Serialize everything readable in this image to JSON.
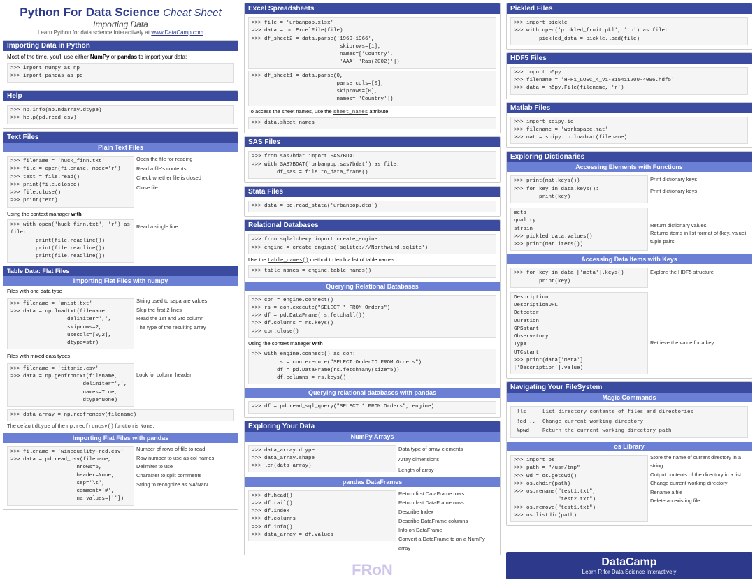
{
  "header": {
    "title_bold": "Python For Data Science",
    "title_italic": "Cheat Sheet",
    "subtitle": "Importing Data",
    "link_text": "Learn Python for data science Interactively at",
    "link_url": "www.DataCamp.com"
  },
  "sections": {
    "importing_python": {
      "title": "Importing Data in Python",
      "body": "Most of the time, you'll use either NumPy or pandas to import your data:",
      "code": ">>> import numpy as np\n>>> import pandas as pd"
    },
    "help": {
      "title": "Help",
      "code": ">>> np.info(np.ndarray.dtype)\n>>> help(pd.read_csv)"
    },
    "text_files": {
      "title": "Text Files",
      "plain_text": {
        "subtitle": "Plain Text Files",
        "code1": ">>> filename = 'huck_finn.txt'\n>>> file = open(filename, mode='r')\n>>> text = file.read()\n>>> print(file.closed)\n>>> file.close()\n>>> print(text)",
        "notes": [
          "Open the file for reading",
          "Read a file's contents",
          "Check whether file is closed",
          "Close file"
        ]
      },
      "context_manager": {
        "label": "Using the context manager with",
        "code": ">>> with open('huck_finn.txt', 'r') as file:\n        print(file.readline())\n        print(file.readline())\n        print(file.readline())",
        "note": "Read a single line"
      },
      "flat_files": {
        "subtitle": "Table Data: Flat Files",
        "numpy_subtitle": "Importing Flat Files with numpy",
        "one_dtype": "Files with one data type",
        "code1": ">>> filename = 'mnist.txt'\n>>> data = np.loadtxt(filename,\n                      delimiter=',',\n                      skiprows=2,\n                      usecols=[0,2],\n                      dtype=str)",
        "notes1": [
          "String used to separate values",
          "Skip the first 2 lines",
          "Read the 1st and 3rd column",
          "The type of the resulting array"
        ],
        "mixed_dtype": "Files with mixed data types",
        "code2": ">>> filename = 'titanic.csv'\n>>> data = np.genfromtxt(filename,\n                         delimiter=',',\n                         names=True,\n                         dtype=None)",
        "note2": "Look for column header",
        "code3": ">>> data_array = np.recfromcsv(filename)",
        "recfrom_note": "The default dtype of the np.recfromcsv() function is None."
      },
      "pandas_flat": {
        "subtitle": "Importing Flat Files with pandas",
        "code": ">>> filename = 'winequality-red.csv'\n>>> data = pd.read_csv(filename,\n                       nrows=5,\n                       header=None,\n                       sep='\\t',\n                       comment='#',\n                       na_values=[''])",
        "notes": [
          "Number of rows of file to read",
          "Row number to use as col names",
          "Delimiter to use",
          "Character to split comments",
          "String to recognize as NA/NaN"
        ]
      }
    },
    "excel": {
      "title": "Excel Spreadsheets",
      "code1": ">>> file = 'urbanpop.xlsx'\n>>> data = pd.ExcelFile(file)\n>>> df_sheet2 = data.parse('1960-1966',\n                            skiprows=[1],\n                            names=['Country',\n                            'AAA' 'Ras(2002)'])",
      "code2": ">>> df_sheet1 = data.parse(0,\n                           parse_cols=[0],\n                           skiprows=[0],\n                           names=['Country'])",
      "sheet_names": "To access the sheet names, use the sheet_names attribute:",
      "code3": ">>> data.sheet_names"
    },
    "sas": {
      "title": "SAS Files",
      "code": ">>> from sas7bdat import SAS7BDAT\n>>> with SAS7BDAT('urbanpop.sas7bdat') as file:\n        df_sas = file.to_data_frame()"
    },
    "stata": {
      "title": "Stata Files",
      "code": ">>> data = pd.read_stata('urbanpop.dta')"
    },
    "relational_db": {
      "title": "Relational Databases",
      "code1": ">>> from sqlalchemy import create_engine\n>>> engine = create_engine('sqlite:///Northwind.sqlite')",
      "table_names": "Use the table_names() method to fetch a list of table names:",
      "code2": ">>> table_names = engine.table_names()",
      "querying_title": "Querying Relational Databases",
      "code3": ">>> con = engine.connect()\n>>> rs = con.execute(\"SELECT * FROM Orders\")\n>>> df = pd.DataFrame(rs.fetchall())\n>>> df.columns = rs.keys()\n>>> con.close()",
      "context_label": "Using the context manager with",
      "code4": ">>> with engine.connect() as con:\n        rs = con.execute(\"SELECT OrderID FROM Orders\")\n        df = pd.DataFrame(rs.fetchmany(size=5))\n        df.columns = rs.keys()",
      "pandas_title": "Querying relational databases with pandas",
      "code5": ">>> df = pd.read_sql_query(\"SELECT * FROM Orders\", engine)"
    },
    "exploring": {
      "title": "Exploring Your Data",
      "numpy_title": "NumPy Arrays",
      "numpy_code": ">>> data_array.dtype\n>>> data_array.shape\n>>> len(data_array)",
      "numpy_notes": [
        "Data type of array elements",
        "Array dimensions",
        "Length of array"
      ],
      "pandas_title": "pandas DataFrames",
      "pandas_code": ">>> df.head()\n>>> df.tail()\n>>> df.index\n>>> df.columns\n>>> df.info()\n>>> data_array = df.values",
      "pandas_notes": [
        "Return first DataFrame rows",
        "Return last DataFrame rows",
        "Describe Index",
        "Describe DataFrame columns",
        "Info on DataFrame",
        "Convert a DataFrame to an a NumPy array"
      ]
    },
    "pickled": {
      "title": "Pickled Files",
      "code": ">>> import pickle\n>>> with open('pickled_fruit.pkl', 'rb') as file:\n        pickled_data = pickle.load(file)"
    },
    "hdf5": {
      "title": "HDF5 Files",
      "code": ">>> import h5py\n>>> filename = 'H-H1_LOSC_4_V1-815411200-4096.hdf5'\n>>> data = h5py.File(filename, 'r')"
    },
    "matlab": {
      "title": "Matlab Files",
      "code": ">>> import scipy.io\n>>> filename = 'workspace.mat'\n>>> mat = scipy.io.loadmat(filename)"
    },
    "exploring_dicts": {
      "title": "Exploring Dictionaries",
      "access_title": "Accessing Elements with Functions",
      "access_code": ">>> print(mat.keys())\n>>> for key in data.keys():\n        print(key)",
      "access_notes": [
        "Print dictionary keys",
        "Print dictionary keys"
      ],
      "list_code": "meta\nquality\nstrain\n>>> pickled_data.values()\n>>> print(mat.items())",
      "list_notes": [
        "Return dictionary values",
        "Returns items in list format of (key, value) tuple pairs"
      ],
      "keys_title": "Accessing Data Items with Keys",
      "keys_code": ">>> for key in data ['meta'].keys()\n        print(key)",
      "keys_note": "Explore the HDF5 structure",
      "keys_list": "Description\nDescriptionURL\nDetector\nDuration\nGPSstart\nObservatory\nType\nUTCstart\n>>> print(data['meta']['Description'].value)",
      "keys_list_note": "Retrieve the value for a key"
    },
    "filesystem": {
      "title": "Navigating Your FileSystem",
      "magic_title": "Magic Commands",
      "magic_rows": [
        {
          "cmd": "!ls",
          "desc": "List directory contents of files and directories"
        },
        {
          "cmd": "!cd ..",
          "desc": "Change current working directory"
        },
        {
          "cmd": "%pwd",
          "desc": "Return the current working directory path"
        }
      ],
      "os_title": "os Library",
      "os_code": ">>> import os\n>>> path = \"/usr/tmp\"\n>>> wd = os.getcwd()\n>>> os.chdir(path)\n>>> os.rename(\"test1.txt\",\n              \"test2.txt\")\n>>> os.remove(\"test1.txt\")\n>>> os.listdir(path)",
      "os_notes": [
        "Store the name of current directory in a string",
        "Output contents of the directory in a list",
        "Change current working directory",
        "Rename a file",
        "",
        "Delete an existing file",
        ""
      ]
    }
  },
  "footer": {
    "brand": "DataCamp",
    "subtitle": "Learn R for Data Science Interactively"
  }
}
